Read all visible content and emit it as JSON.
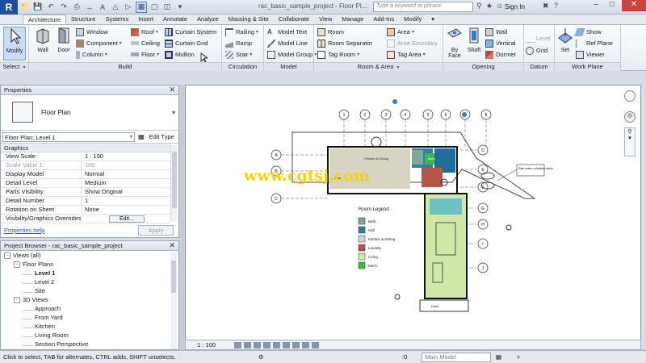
{
  "titlebar": {
    "logo": "R",
    "doc_title": "rac_basic_sample_project - Floor Pl...",
    "search_placeholder": "Type a keyword or phrase",
    "signin": "Sign In"
  },
  "tabs": [
    "Architecture",
    "Structure",
    "Systems",
    "Insert",
    "Annotate",
    "Analyze",
    "Massing & Site",
    "Collaborate",
    "View",
    "Manage",
    "Add-Ins",
    "Modify"
  ],
  "ribbon": {
    "select": {
      "modify": "Modify",
      "panel": "Select"
    },
    "build": {
      "panel": "Build",
      "wall": "Wall",
      "door": "Door",
      "window": "Window",
      "component": "Component",
      "column": "Column",
      "roof": "Roof",
      "ceiling": "Ceiling",
      "floor": "Floor",
      "curtain_system": "Curtain System",
      "curtain_grid": "Curtain Grid",
      "mullion": "Mullion"
    },
    "circulation": {
      "panel": "Circulation",
      "railing": "Railing",
      "ramp": "Ramp",
      "stair": "Stair"
    },
    "model": {
      "panel": "Model",
      "model_text": "Model Text",
      "model_line": "Model Line",
      "model_group": "Model Group"
    },
    "room_area": {
      "panel": "Room & Area",
      "room": "Room",
      "room_separator": "Room Separator",
      "tag_room": "Tag Room",
      "area": "Area",
      "area_boundary": "Area Boundary",
      "tag_area": "Tag Area"
    },
    "opening": {
      "panel": "Opening",
      "by_face": "By Face",
      "shaft": "Shaft",
      "wall": "Wall",
      "vertical": "Vertical",
      "dormer": "Dormer"
    },
    "datum": {
      "panel": "Datum",
      "level": "Level",
      "grid": "Grid"
    },
    "work_plane": {
      "panel": "Work Plane",
      "set": "Set",
      "show": "Show",
      "ref_plane": "Ref Plane",
      "viewer": "Viewer"
    }
  },
  "properties": {
    "title": "Properties",
    "type_name": "Floor Plan",
    "instance": "Floor Plan: Level 1",
    "edit_type": "Edit Type",
    "group": "Graphics",
    "rows": [
      {
        "name": "View Scale",
        "value": "1 : 100"
      },
      {
        "name": "Scale Value    1:",
        "value": "100"
      },
      {
        "name": "Display Model",
        "value": "Normal"
      },
      {
        "name": "Detail Level",
        "value": "Medium"
      },
      {
        "name": "Parts Visibility",
        "value": "Show Original"
      },
      {
        "name": "Detail Number",
        "value": "1"
      },
      {
        "name": "Rotation on Sheet",
        "value": "None"
      },
      {
        "name": "Visibility/Graphics Overrides",
        "value": "Edit..."
      }
    ],
    "help": "Properties help",
    "apply": "Apply"
  },
  "browser": {
    "title": "Project Browser - rac_basic_sample_project",
    "nodes": [
      {
        "label": "Views (all)",
        "level": 0,
        "exp": "-"
      },
      {
        "label": "Floor Plans",
        "level": 1,
        "exp": "-"
      },
      {
        "label": "Level 1",
        "level": 2,
        "exp": "",
        "selected": true
      },
      {
        "label": "Level 2",
        "level": 2,
        "exp": ""
      },
      {
        "label": "Site",
        "level": 2,
        "exp": ""
      },
      {
        "label": "3D Views",
        "level": 1,
        "exp": "-"
      },
      {
        "label": "Approach",
        "level": 2,
        "exp": ""
      },
      {
        "label": "From Yard",
        "level": 2,
        "exp": ""
      },
      {
        "label": "Kitchen",
        "level": 2,
        "exp": ""
      },
      {
        "label": "Living Room",
        "level": 2,
        "exp": ""
      },
      {
        "label": "Section Perspective",
        "level": 2,
        "exp": ""
      }
    ]
  },
  "drawing": {
    "legend_title": "Room Legend",
    "legend": [
      {
        "label": "Bath",
        "color": "#7fa89c"
      },
      {
        "label": "Hall",
        "color": "#2f7fa8"
      },
      {
        "label": "Kitchen & Dining",
        "color": "#d9d3c4"
      },
      {
        "label": "Laundry",
        "color": "#b5564a"
      },
      {
        "label": "Living",
        "color": "#cfe8a8"
      },
      {
        "label": "Mech.",
        "color": "#3fb84a"
      }
    ],
    "grid_top": [
      "1",
      "2",
      "3",
      "4",
      "5",
      "6",
      "7",
      "8"
    ],
    "grid_left": [
      "A",
      "B",
      "C"
    ],
    "grid_right": [
      "D",
      "E",
      "F",
      "G",
      "H",
      "I",
      "J"
    ],
    "tag_callout": "Rain water collection tanks",
    "kitchen_label": "Kitchen & Dining",
    "bath_label": "Bath",
    "mech_label": "Mech.",
    "deck_label": "Deck",
    "watermark": "www.cgtsj.com"
  },
  "viewbar": {
    "scale": "1 : 100"
  },
  "status": {
    "text": "Click to select, TAB for alternates, CTRL adds, SHIFT unselects.",
    "zoom": ":0",
    "workset": "Main Model"
  }
}
